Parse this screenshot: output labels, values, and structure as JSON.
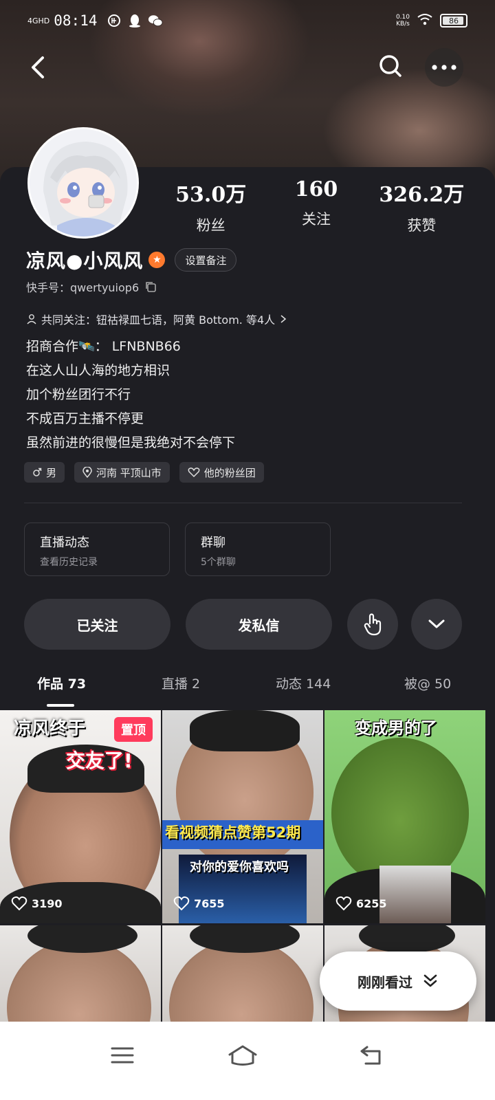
{
  "status_bar": {
    "network": "4GHD",
    "time": "08:14",
    "speed_value": "0.10",
    "speed_unit": "KB/s",
    "battery": "86"
  },
  "profile": {
    "stats": [
      {
        "value": "53.0万",
        "label": "粉丝"
      },
      {
        "value": "160",
        "label": "关注"
      },
      {
        "value": "326.2万",
        "label": "获赞"
      }
    ],
    "name": "凉风●小风风",
    "note_button": "设置备注",
    "kuaishou_id": "快手号：qwertyuiop6",
    "mutual_follows": "共同关注：钮祜禄皿七语，阿黄 Bottom. 等4人",
    "bio_lines": [
      "招商合作🛰️： LFNBNB66",
      "在这人山人海的地方相识",
      "加个粉丝团行不行",
      "不成百万主播不停更",
      "虽然前进的很慢但是我绝对不会停下"
    ],
    "tags": [
      "男",
      "河南 平顶山市",
      "他的粉丝团"
    ]
  },
  "quick_cards": [
    {
      "title": "直播动态",
      "subtitle": "查看历史记录"
    },
    {
      "title": "群聊",
      "subtitle": "5个群聊"
    }
  ],
  "actions": {
    "follow": "已关注",
    "message": "发私信"
  },
  "tabs": [
    {
      "label": "作品 73",
      "active": true
    },
    {
      "label": "直播 2",
      "active": false
    },
    {
      "label": "动态 144",
      "active": false
    },
    {
      "label": "被@ 50",
      "active": false
    }
  ],
  "videos": [
    {
      "likes": "3190",
      "text_top": "凉风终于",
      "text_mid": "交友了!",
      "pinned": "置顶"
    },
    {
      "likes": "7655",
      "text_banner": "看视频猜点赞第52期",
      "text_sub": "对你的爱你喜欢吗"
    },
    {
      "likes": "6255",
      "text_top": "变成男的了"
    }
  ],
  "recent_button": "刚刚看过",
  "colors": {
    "card_bg": "#1e1e23",
    "pill_bg": "#34343a",
    "orange_badge": "#ff7a2e",
    "pin_red": "#ff3b5c"
  }
}
